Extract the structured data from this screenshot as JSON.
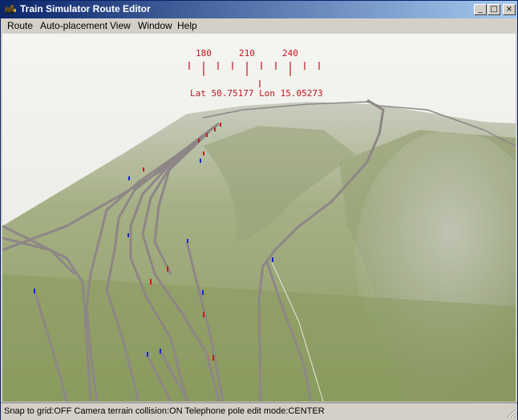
{
  "window": {
    "title": "Train Simulator Route Editor",
    "minimize_label": "_",
    "maximize_label": "□",
    "close_label": "×"
  },
  "menu": {
    "items": [
      "Route",
      "Auto-placement",
      "View",
      "Window",
      "Help"
    ]
  },
  "compass": {
    "heading_labels": [
      "180",
      "210",
      "240"
    ],
    "position_readout": "Lat 50.75177 Lon 15.05273",
    "color": "#c0141e"
  },
  "status": {
    "text": "Snap to grid:OFF Camera terrain collision:ON Telephone pole edit mode:CENTER"
  },
  "colors": {
    "title_active": "#0a246a",
    "title_gradient_end": "#a6caf0",
    "sky": "#f0f0ec",
    "terrain": "#8f9e6a",
    "rail": "#8e8686",
    "marker_red": "#d01818",
    "marker_blue": "#1828c8"
  },
  "icons": {
    "app": "locomotive-icon",
    "resize": "resize-grip-icon"
  }
}
